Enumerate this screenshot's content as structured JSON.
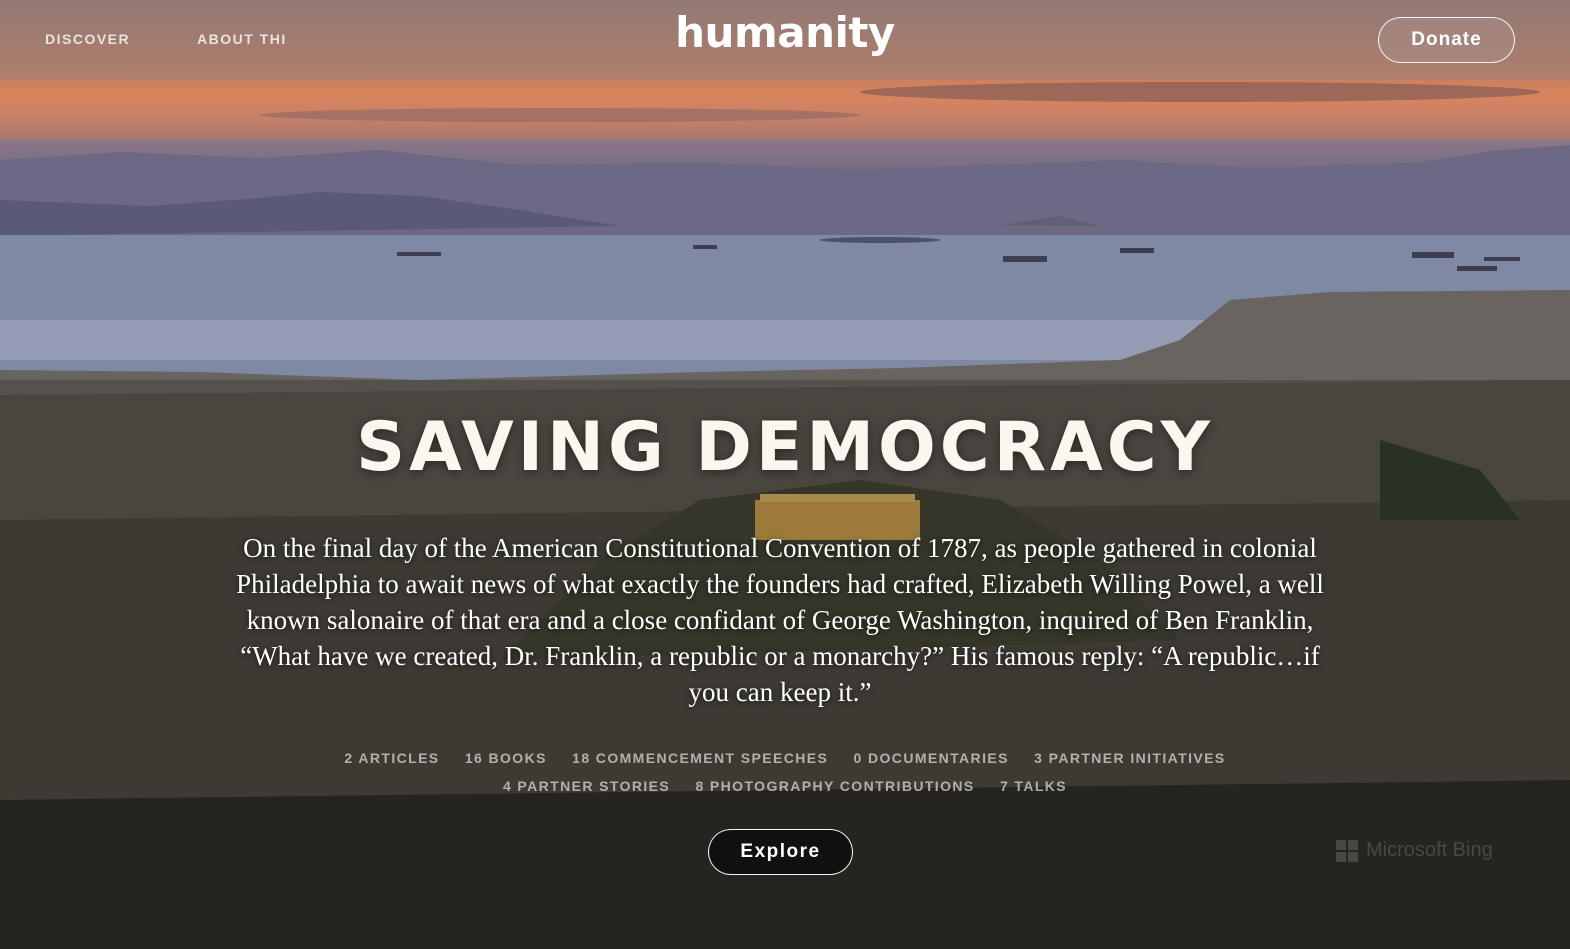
{
  "nav": {
    "links": [
      "DISCOVER",
      "ABOUT THI"
    ],
    "logo": "humanity",
    "donate_label": "Donate"
  },
  "hero": {
    "title": "SAVING DEMOCRACY",
    "description": "On the final day of the American Constitutional Convention of 1787, as people gathered in colonial Philadelphia to await news of what exactly the founders had crafted, Elizabeth Willing Powel, a well known salonaire of that era and a close confidant of George Washington, inquired of Ben Franklin, “What have we created, Dr. Franklin, a republic or a monarchy?” His famous reply: “A republic…if you can keep it.”",
    "stats_row1": [
      "2 ARTICLES",
      "16 BOOKS",
      "18 COMMENCEMENT SPEECHES",
      "0 DOCUMENTARIES",
      "3 PARTNER INITIATIVES"
    ],
    "stats_row2": [
      "4 PARTNER STORIES",
      "8 PHOTOGRAPHY CONTRIBUTIONS",
      "7 TALKS"
    ],
    "explore_label": "Explore"
  },
  "watermark": "Microsoft Bing",
  "colors": {
    "sunset": "#d98b66",
    "sea": "#8791aa",
    "title": "#fbf7ee"
  }
}
